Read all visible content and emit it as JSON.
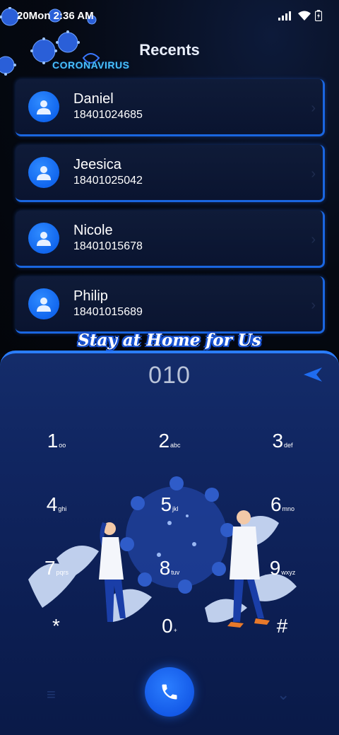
{
  "status_bar": {
    "time": "20Mon 2:36 AM"
  },
  "logo": {
    "text": "CORONAVIRUS"
  },
  "page": {
    "title": "Recents"
  },
  "contacts": [
    {
      "name": "Daniel",
      "number": "18401024685"
    },
    {
      "name": "Jeesica",
      "number": "18401025042"
    },
    {
      "name": "Nicole",
      "number": "18401015678"
    },
    {
      "name": "Philip",
      "number": "18401015689"
    }
  ],
  "banner": {
    "slogan": "Stay at Home for Us"
  },
  "dialer": {
    "entered_number": "010",
    "keys": [
      {
        "digit": "1",
        "letters": "ᴏᴏ"
      },
      {
        "digit": "2",
        "letters": "abc"
      },
      {
        "digit": "3",
        "letters": "def"
      },
      {
        "digit": "4",
        "letters": "ghi"
      },
      {
        "digit": "5",
        "letters": "jkl"
      },
      {
        "digit": "6",
        "letters": "mno"
      },
      {
        "digit": "7",
        "letters": "pqrs"
      },
      {
        "digit": "8",
        "letters": "tuv"
      },
      {
        "digit": "9",
        "letters": "wxyz"
      },
      {
        "digit": "*",
        "letters": ""
      },
      {
        "digit": "0",
        "letters": "+"
      },
      {
        "digit": "#",
        "letters": ""
      }
    ]
  },
  "colors": {
    "accent": "#1a66e0",
    "dialer_bg": "#102560",
    "call_button": "#1257e6",
    "logo_text": "#48c2ff"
  },
  "icons": {
    "signal": "signal-icon",
    "wifi": "wifi-icon",
    "battery": "battery-icon",
    "avatar": "person-icon",
    "chevron": "chevron-right-icon",
    "backspace": "backspace-icon",
    "call": "phone-icon",
    "menu": "menu-icon",
    "collapse": "collapse-icon"
  }
}
